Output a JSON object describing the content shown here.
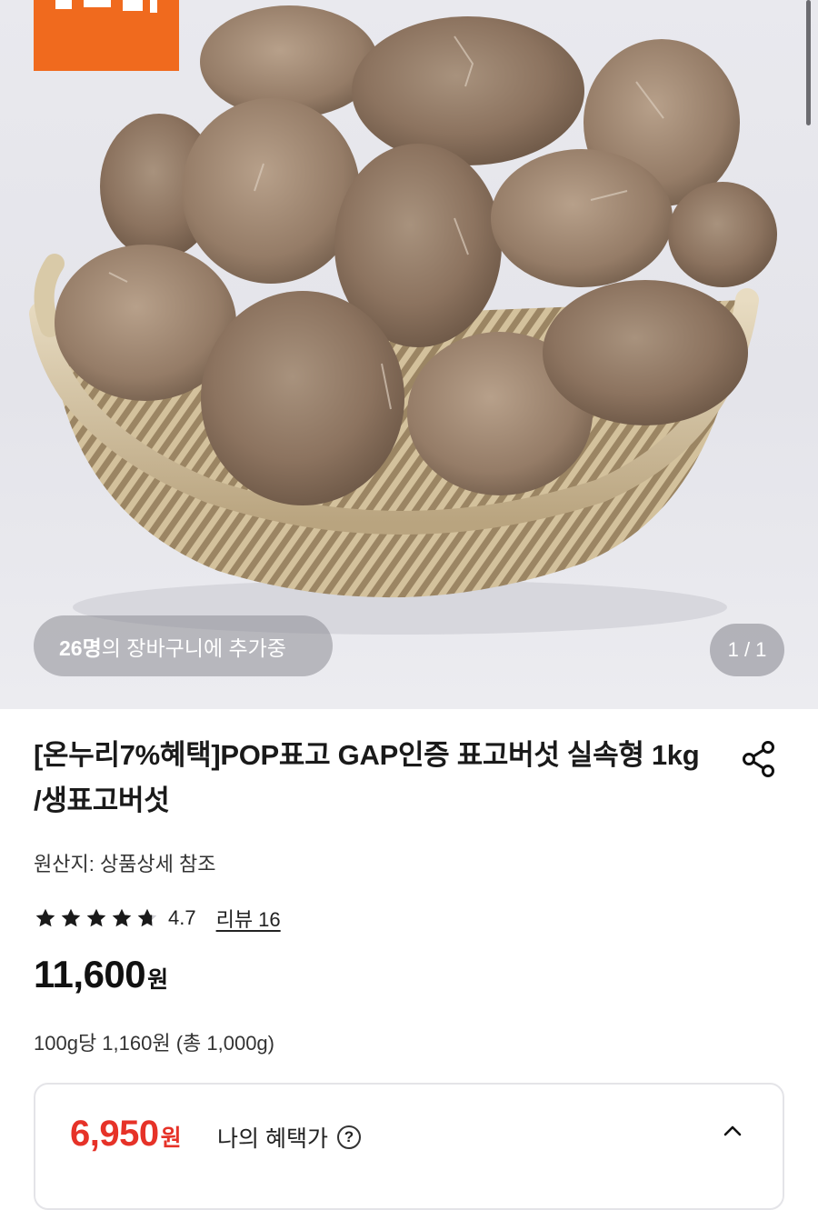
{
  "hero": {
    "image_alt": "bamboo basket full of fresh shiitake mushrooms",
    "cart_count": "26명",
    "cart_text": "의 장바구니에 추가중",
    "page_indicator": "1 / 1"
  },
  "product": {
    "title": "[온누리7%혜택]POP표고 GAP인증 표고버섯 실속형 1kg /생표고버섯",
    "origin": "원산지: 상품상세 참조",
    "rating": {
      "value": "4.7",
      "stars": 4.7,
      "max": 5
    },
    "review_link": "리뷰 16",
    "price": "11,600",
    "price_unit": "원",
    "unit_price": "100g당 1,160원 (총 1,000g)"
  },
  "benefit": {
    "price": "6,950",
    "price_unit": "원",
    "label": "나의 혜택가",
    "help_glyph": "?"
  },
  "icons": [
    "share-icon",
    "star-icon",
    "help-icon",
    "chevron-up-icon"
  ],
  "colors": {
    "brand_orange": "#f06a1e",
    "benefit_red": "#e63228",
    "text": "#111111"
  }
}
